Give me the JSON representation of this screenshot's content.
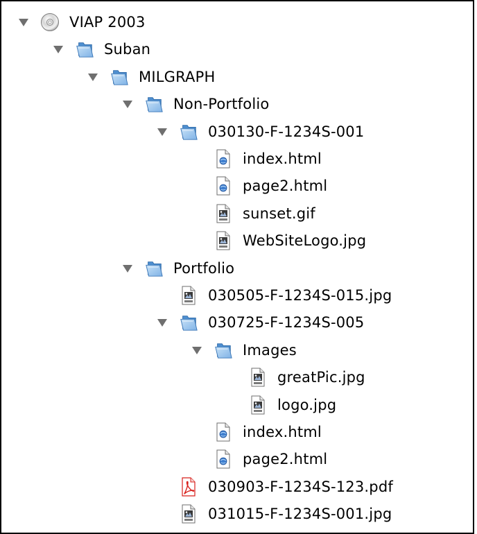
{
  "tree": [
    {
      "label": "VIAP 2003",
      "depth": 0,
      "icon": "cd-disc-icon",
      "expanded": true
    },
    {
      "label": "Suban",
      "depth": 1,
      "icon": "folder-icon",
      "expanded": true
    },
    {
      "label": "MILGRAPH",
      "depth": 2,
      "icon": "folder-icon",
      "expanded": true
    },
    {
      "label": "Non-Portfolio",
      "depth": 3,
      "icon": "folder-icon",
      "expanded": true
    },
    {
      "label": "030130-F-1234S-001",
      "depth": 4,
      "icon": "folder-icon",
      "expanded": true
    },
    {
      "label": "index.html",
      "depth": 5,
      "icon": "html-file-icon",
      "expanded": null
    },
    {
      "label": "page2.html",
      "depth": 5,
      "icon": "html-file-icon",
      "expanded": null
    },
    {
      "label": "sunset.gif",
      "depth": 5,
      "icon": "image-file-icon",
      "expanded": null
    },
    {
      "label": "WebSiteLogo.jpg",
      "depth": 5,
      "icon": "image-file-icon",
      "expanded": null
    },
    {
      "label": "Portfolio",
      "depth": 3,
      "icon": "folder-icon",
      "expanded": true
    },
    {
      "label": "030505-F-1234S-015.jpg",
      "depth": 4,
      "icon": "image-file-icon",
      "expanded": null
    },
    {
      "label": "030725-F-1234S-005",
      "depth": 4,
      "icon": "folder-icon",
      "expanded": true
    },
    {
      "label": "Images",
      "depth": 5,
      "icon": "folder-icon",
      "expanded": true
    },
    {
      "label": "greatPic.jpg",
      "depth": 6,
      "icon": "image-file-icon",
      "expanded": null
    },
    {
      "label": "logo.jpg",
      "depth": 6,
      "icon": "image-file-icon",
      "expanded": null
    },
    {
      "label": "index.html",
      "depth": 5,
      "icon": "html-file-icon",
      "expanded": null
    },
    {
      "label": "page2.html",
      "depth": 5,
      "icon": "html-file-icon",
      "expanded": null
    },
    {
      "label": "030903-F-1234S-123.pdf",
      "depth": 4,
      "icon": "pdf-file-icon",
      "expanded": null
    },
    {
      "label": "031015-F-1234S-001.jpg",
      "depth": 4,
      "icon": "image-file-icon",
      "expanded": null
    }
  ],
  "colors": {
    "triangle": "#6f6f6f",
    "folder_light": "#c7e1f7",
    "folder_dark": "#4e8fd0",
    "pdf_red": "#d8201c"
  }
}
